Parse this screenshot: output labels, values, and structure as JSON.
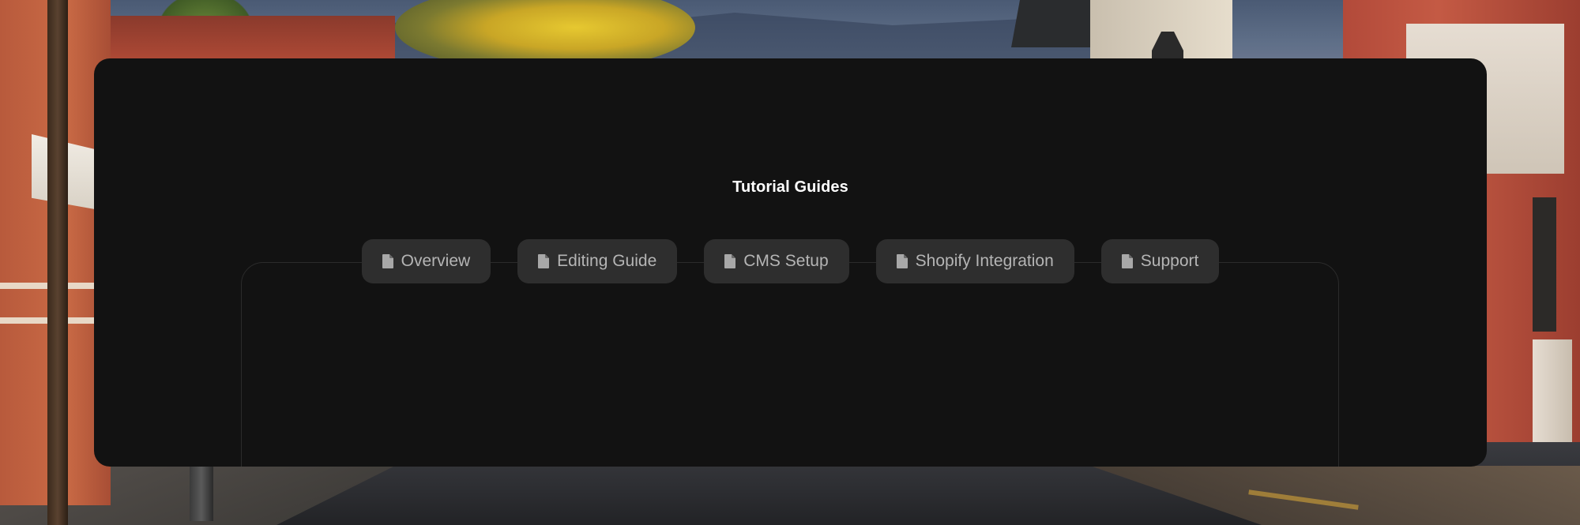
{
  "panel": {
    "title": "Tutorial Guides"
  },
  "tabs": [
    {
      "label": "Overview",
      "icon": "document-icon"
    },
    {
      "label": "Editing Guide",
      "icon": "document-icon"
    },
    {
      "label": "CMS Setup",
      "icon": "document-icon"
    },
    {
      "label": "Shopify Integration",
      "icon": "document-icon"
    },
    {
      "label": "Support",
      "icon": "document-icon"
    }
  ],
  "colors": {
    "panel_bg": "#121212",
    "tab_bg": "#2e2e2e",
    "tab_text": "#b5b5b5",
    "title_text": "#ffffff"
  }
}
